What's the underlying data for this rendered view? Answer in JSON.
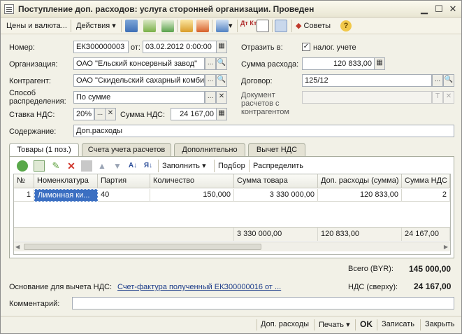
{
  "window": {
    "title": "Поступление доп. расходов: услуга сторонней организации. Проведен"
  },
  "toolbar": {
    "prices": "Цены и валюта...",
    "actions": "Действия",
    "dt_kt": "Дт Кт",
    "advice": "Советы"
  },
  "form": {
    "number_label": "Номер:",
    "number_value": "ЕКЗ00000003",
    "date_label": "от:",
    "date_value": "03.02.2012  0:00:00",
    "org_label": "Организация:",
    "org_value": "ОАО \"Ельский консервный завод\"",
    "counterparty_label": "Контрагент:",
    "counterparty_value": "ОАО \"Скидельский сахарный комби",
    "distrib_label": "Способ распределения:",
    "distrib_value": "По сумме",
    "vat_rate_label": "Ставка НДС:",
    "vat_rate_value": "20%",
    "vat_sum_label": "Сумма НДС:",
    "vat_sum_value": "24 167,00",
    "content_label": "Содержание:",
    "content_value": "Доп.расходы",
    "reflect_label": "Отразить в:",
    "reflect_check": "налог. учете",
    "expense_label": "Сумма расхода:",
    "expense_value": "120 833,00",
    "contract_label": "Договор:",
    "contract_value": "125/12",
    "settlement_doc_label": "Документ расчетов с контрагентом"
  },
  "tabs": [
    {
      "label": "Товары (1 поз.)"
    },
    {
      "label": "Счета учета расчетов"
    },
    {
      "label": "Дополнительно"
    },
    {
      "label": "Вычет НДС"
    }
  ],
  "gridbar": {
    "fill": "Заполнить",
    "selection": "Подбор",
    "distribute": "Распределить"
  },
  "table": {
    "headers": [
      "№",
      "Номенклатура",
      "Партия",
      "Количество",
      "Сумма товара",
      "Доп. расходы (сумма)",
      "Сумма НДС"
    ],
    "rows": [
      {
        "n": "1",
        "item": "Лимонная ки...",
        "batch": "40",
        "qty": "150,000",
        "sum": "3 330 000,00",
        "extra": "120 833,00",
        "vat": "2"
      }
    ],
    "totals": {
      "sum": "3 330 000,00",
      "extra": "120 833,00",
      "vat": "24 167,00"
    }
  },
  "summary": {
    "total_label": "Всего (BYR):",
    "total_value": "145 000,00",
    "vat_label": "НДС (сверху):",
    "vat_value": "24 167,00",
    "basis_label": "Основание для вычета НДС:",
    "basis_link": "Счет-фактура полученный ЕКЗ00000016 от ...",
    "comment_label": "Комментарий:",
    "comment_value": ""
  },
  "bottom": {
    "extra_costs": "Доп. расходы",
    "print": "Печать",
    "ok": "OK",
    "save": "Записать",
    "close": "Закрыть"
  }
}
